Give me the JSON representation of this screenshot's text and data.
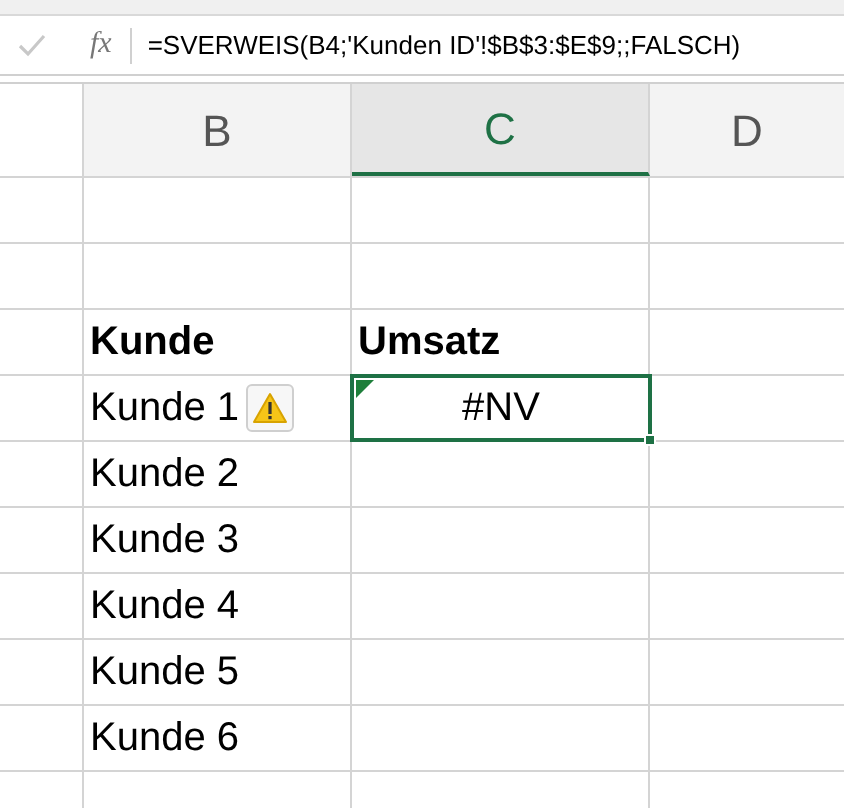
{
  "formula_bar": {
    "fx": "fx",
    "formula": "=SVERWEIS(B4;'Kunden ID'!$B$3:$E$9;;FALSCH)"
  },
  "columns": [
    {
      "label": "B",
      "selected": false
    },
    {
      "label": "C",
      "selected": true
    },
    {
      "label": "D",
      "selected": false
    }
  ],
  "header": [
    "Kunde",
    "Umsatz"
  ],
  "rows": [
    {
      "customer": "Kunde 1",
      "warning": true,
      "value": "#NV",
      "selected": true,
      "error_marker": true
    },
    {
      "customer": "Kunde 2",
      "warning": false,
      "selected": false,
      "error_marker": false
    },
    {
      "customer": "Kunde 3",
      "warning": false,
      "selected": false,
      "error_marker": false
    },
    {
      "customer": "Kunde 4",
      "warning": false,
      "selected": false,
      "error_marker": false
    },
    {
      "customer": "Kunde 5",
      "warning": false,
      "selected": false,
      "error_marker": false
    },
    {
      "customer": "Kunde 6",
      "warning": false,
      "selected": false,
      "error_marker": false
    }
  ]
}
